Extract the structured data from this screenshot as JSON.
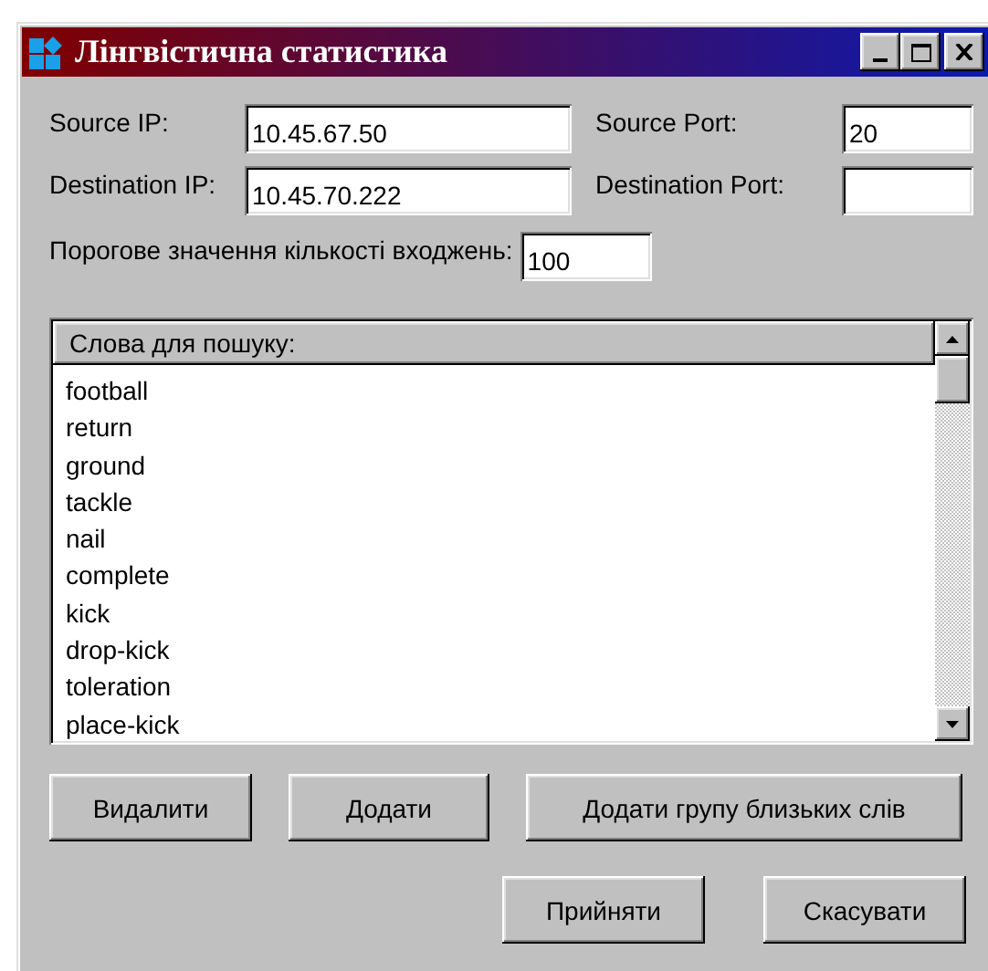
{
  "window": {
    "title": "Лінгвістична статистика"
  },
  "fields": [
    {
      "label": "Source IP:",
      "value": "10.45.67.50"
    },
    {
      "label": "Source Port:",
      "value": "20"
    },
    {
      "label": "Destination IP:",
      "value": "10.45.70.222"
    },
    {
      "label": "Destination Port:"
    }
  ],
  "threshold": {
    "label": "Порогове значення кількості входжень:",
    "value": "100"
  },
  "word_list": {
    "header": "Слова для пошуку:",
    "items": [
      "football",
      "return",
      "ground",
      "tackle",
      "nail",
      "complete",
      "kick",
      "drop-kick",
      "toleration",
      "place-kick"
    ]
  },
  "action_buttons": [
    "Видалити",
    "Додати",
    "Додати групу близьких слів"
  ],
  "dialog_buttons": [
    "Прийняти",
    "Скасувати"
  ]
}
